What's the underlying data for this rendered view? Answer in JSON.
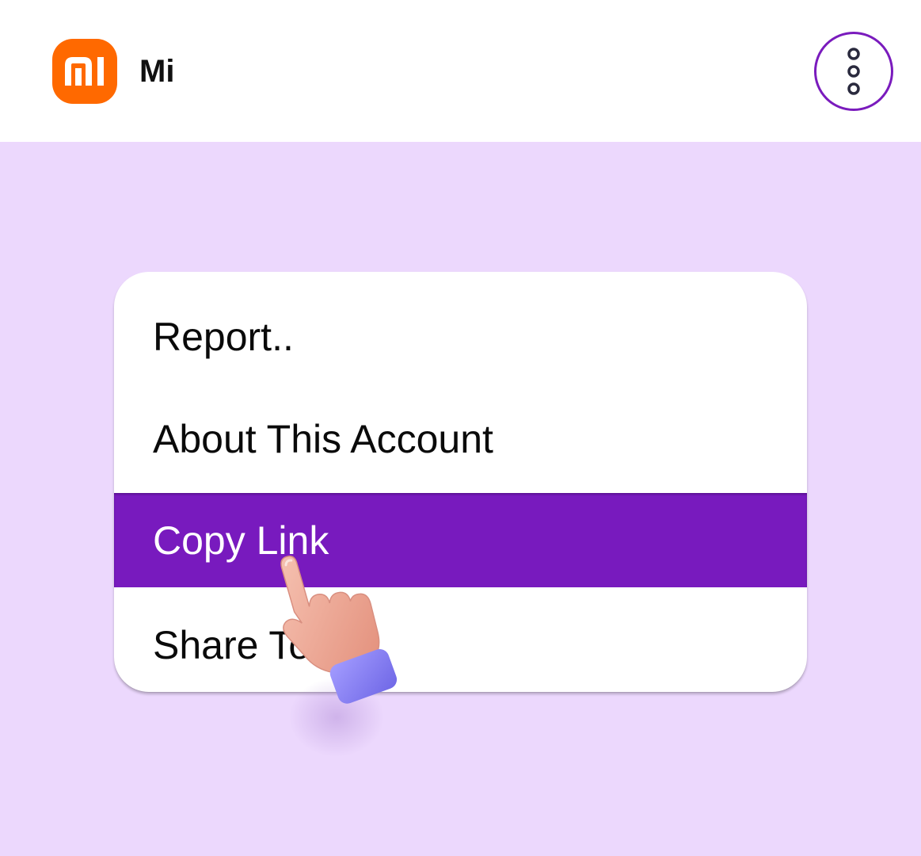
{
  "app": {
    "name": "Mi",
    "logo_text": "mi",
    "brand_color": "#ff6900",
    "accent_color": "#781abe",
    "background_color": "#ecd8fd"
  },
  "header": {
    "more_button_icon": "more-vertical-icon"
  },
  "menu": {
    "items": [
      {
        "label": "Report..",
        "active": false
      },
      {
        "label": "About This Account",
        "active": false
      },
      {
        "label": "Copy Link",
        "active": true
      },
      {
        "label": "Share To..",
        "active": false
      }
    ]
  },
  "overlay": {
    "cursor_icon": "pointing-hand-icon"
  }
}
